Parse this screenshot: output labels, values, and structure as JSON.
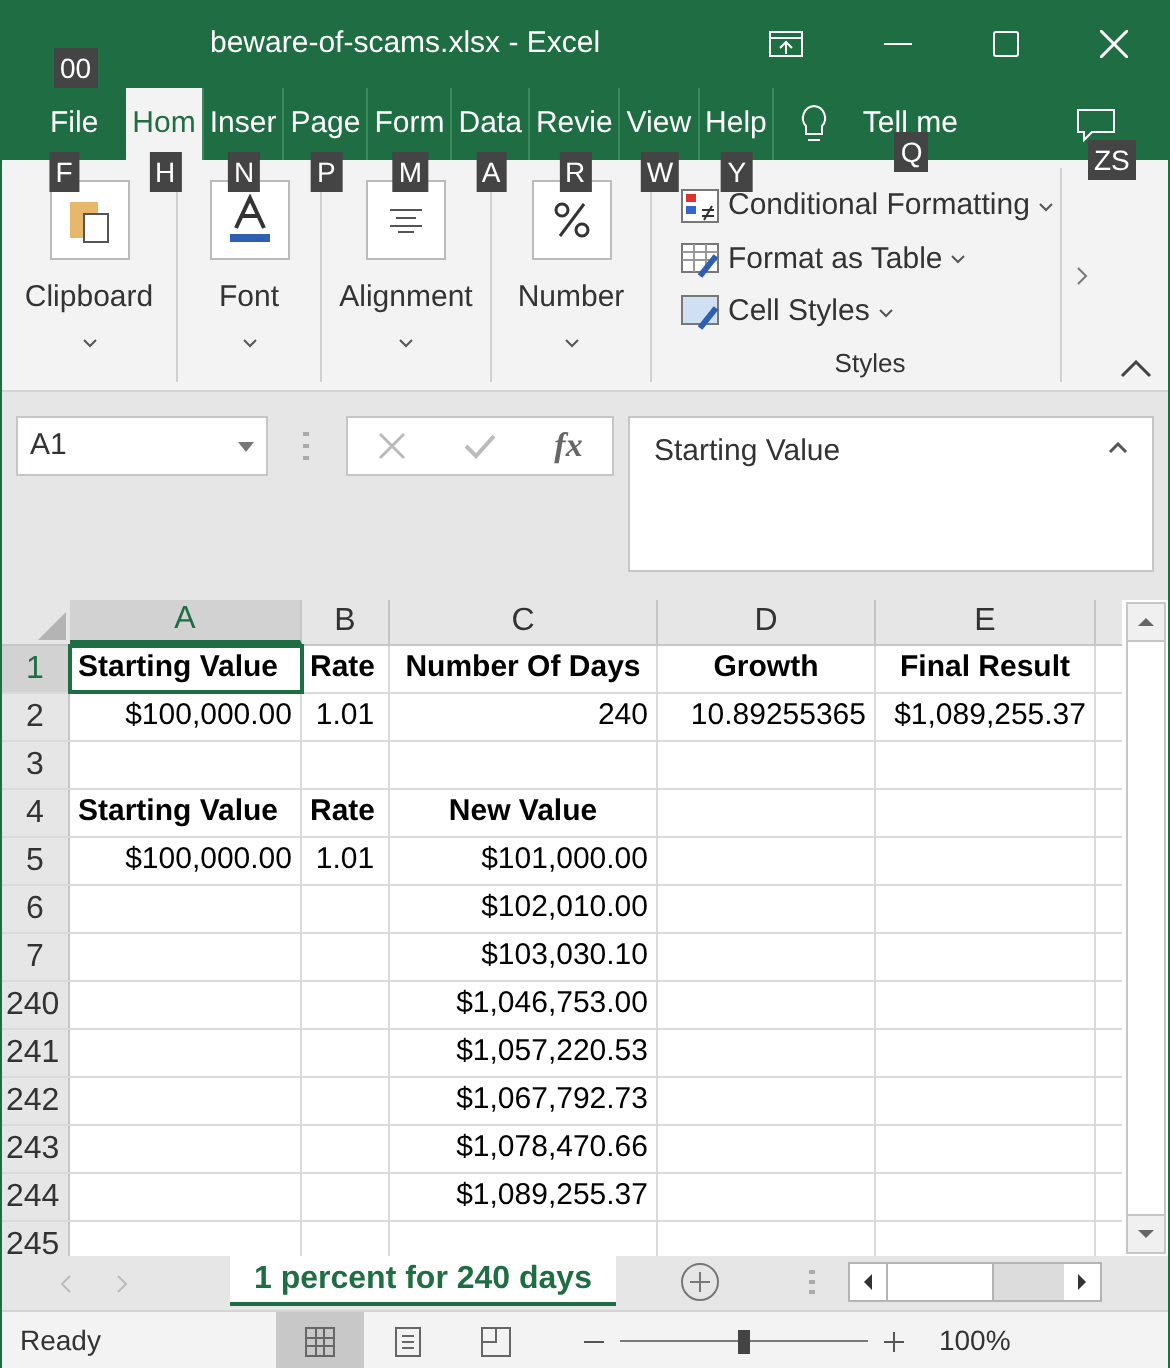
{
  "window": {
    "title": "beware-of-scams.xlsx  -  Excel",
    "quick_access_keytip": "00"
  },
  "tabs": [
    {
      "label": "File",
      "keytip": "F",
      "selected": false
    },
    {
      "label": "Hom",
      "keytip": "H",
      "selected": true
    },
    {
      "label": "Inser",
      "keytip": "N",
      "selected": false
    },
    {
      "label": "Page",
      "keytip": "P",
      "selected": false
    },
    {
      "label": "Form",
      "keytip": "M",
      "selected": false
    },
    {
      "label": "Data",
      "keytip": "A",
      "selected": false
    },
    {
      "label": "Revie",
      "keytip": "R",
      "selected": false
    },
    {
      "label": "View",
      "keytip": "W",
      "selected": false
    },
    {
      "label": "Help",
      "keytip": "Y",
      "selected": false
    }
  ],
  "tell_me": {
    "label": "Tell me",
    "keytip": "Q"
  },
  "comments": {
    "keytip": "ZS"
  },
  "ribbon": {
    "groups": [
      {
        "kind": "clipboard",
        "label": "Clipboard"
      },
      {
        "kind": "font",
        "label": "Font"
      },
      {
        "kind": "alignment",
        "label": "Alignment"
      },
      {
        "kind": "number",
        "label": "Number"
      }
    ],
    "styles": {
      "label": "Styles",
      "items": [
        {
          "kind": "conditional",
          "label": "Conditional Formatting"
        },
        {
          "kind": "table",
          "label": "Format as Table"
        },
        {
          "kind": "cell",
          "label": "Cell Styles"
        }
      ]
    }
  },
  "formula_bar": {
    "name_box": "A1",
    "fx": "fx",
    "value": "Starting Value"
  },
  "columns": [
    {
      "label": "A",
      "selected": true
    },
    {
      "label": "B",
      "selected": false
    },
    {
      "label": "C",
      "selected": false
    },
    {
      "label": "D",
      "selected": false
    },
    {
      "label": "E",
      "selected": false
    }
  ],
  "rows": [
    {
      "number": "1",
      "kind": "header",
      "selected": true,
      "cells": [
        "Starting Value",
        "Rate",
        "Number Of Days",
        "Growth",
        "Final Result"
      ]
    },
    {
      "number": "2",
      "kind": "data",
      "selected": false,
      "cells": [
        "$100,000.00",
        "1.01",
        "240",
        "10.89255365",
        "$1,089,255.37"
      ]
    },
    {
      "number": "3",
      "kind": "data",
      "selected": false,
      "cells": [
        null,
        null,
        null,
        null,
        null
      ]
    },
    {
      "number": "4",
      "kind": "header",
      "selected": false,
      "cells": [
        "Starting Value",
        "Rate",
        "New Value",
        null,
        null
      ]
    },
    {
      "number": "5",
      "kind": "data",
      "selected": false,
      "cells": [
        "$100,000.00",
        "1.01",
        "$101,000.00",
        null,
        null
      ]
    },
    {
      "number": "6",
      "kind": "data",
      "selected": false,
      "cells": [
        null,
        null,
        "$102,010.00",
        null,
        null
      ]
    },
    {
      "number": "7",
      "kind": "data",
      "selected": false,
      "cells": [
        null,
        null,
        "$103,030.10",
        null,
        null
      ]
    },
    {
      "number": "240",
      "kind": "data",
      "selected": false,
      "cells": [
        null,
        null,
        "$1,046,753.00",
        null,
        null
      ]
    },
    {
      "number": "241",
      "kind": "data",
      "selected": false,
      "cells": [
        null,
        null,
        "$1,057,220.53",
        null,
        null
      ]
    },
    {
      "number": "242",
      "kind": "data",
      "selected": false,
      "cells": [
        null,
        null,
        "$1,067,792.73",
        null,
        null
      ]
    },
    {
      "number": "243",
      "kind": "data",
      "selected": false,
      "cells": [
        null,
        null,
        "$1,078,470.66",
        null,
        null
      ]
    },
    {
      "number": "244",
      "kind": "data",
      "selected": false,
      "cells": [
        null,
        null,
        "$1,089,255.37",
        null,
        null
      ]
    },
    {
      "number": "245",
      "kind": "data",
      "selected": false,
      "cells": [
        null,
        null,
        null,
        null,
        null
      ]
    }
  ],
  "sheets": [
    {
      "label": "1 percent for 240 days",
      "selected": true
    }
  ],
  "status_bar": {
    "status": "Ready",
    "views": [
      {
        "kind": "normal",
        "selected": true
      },
      {
        "kind": "page_layout",
        "selected": false
      },
      {
        "kind": "page_break",
        "selected": false
      }
    ],
    "zoom": {
      "level": 0.5,
      "label": "100%"
    }
  }
}
